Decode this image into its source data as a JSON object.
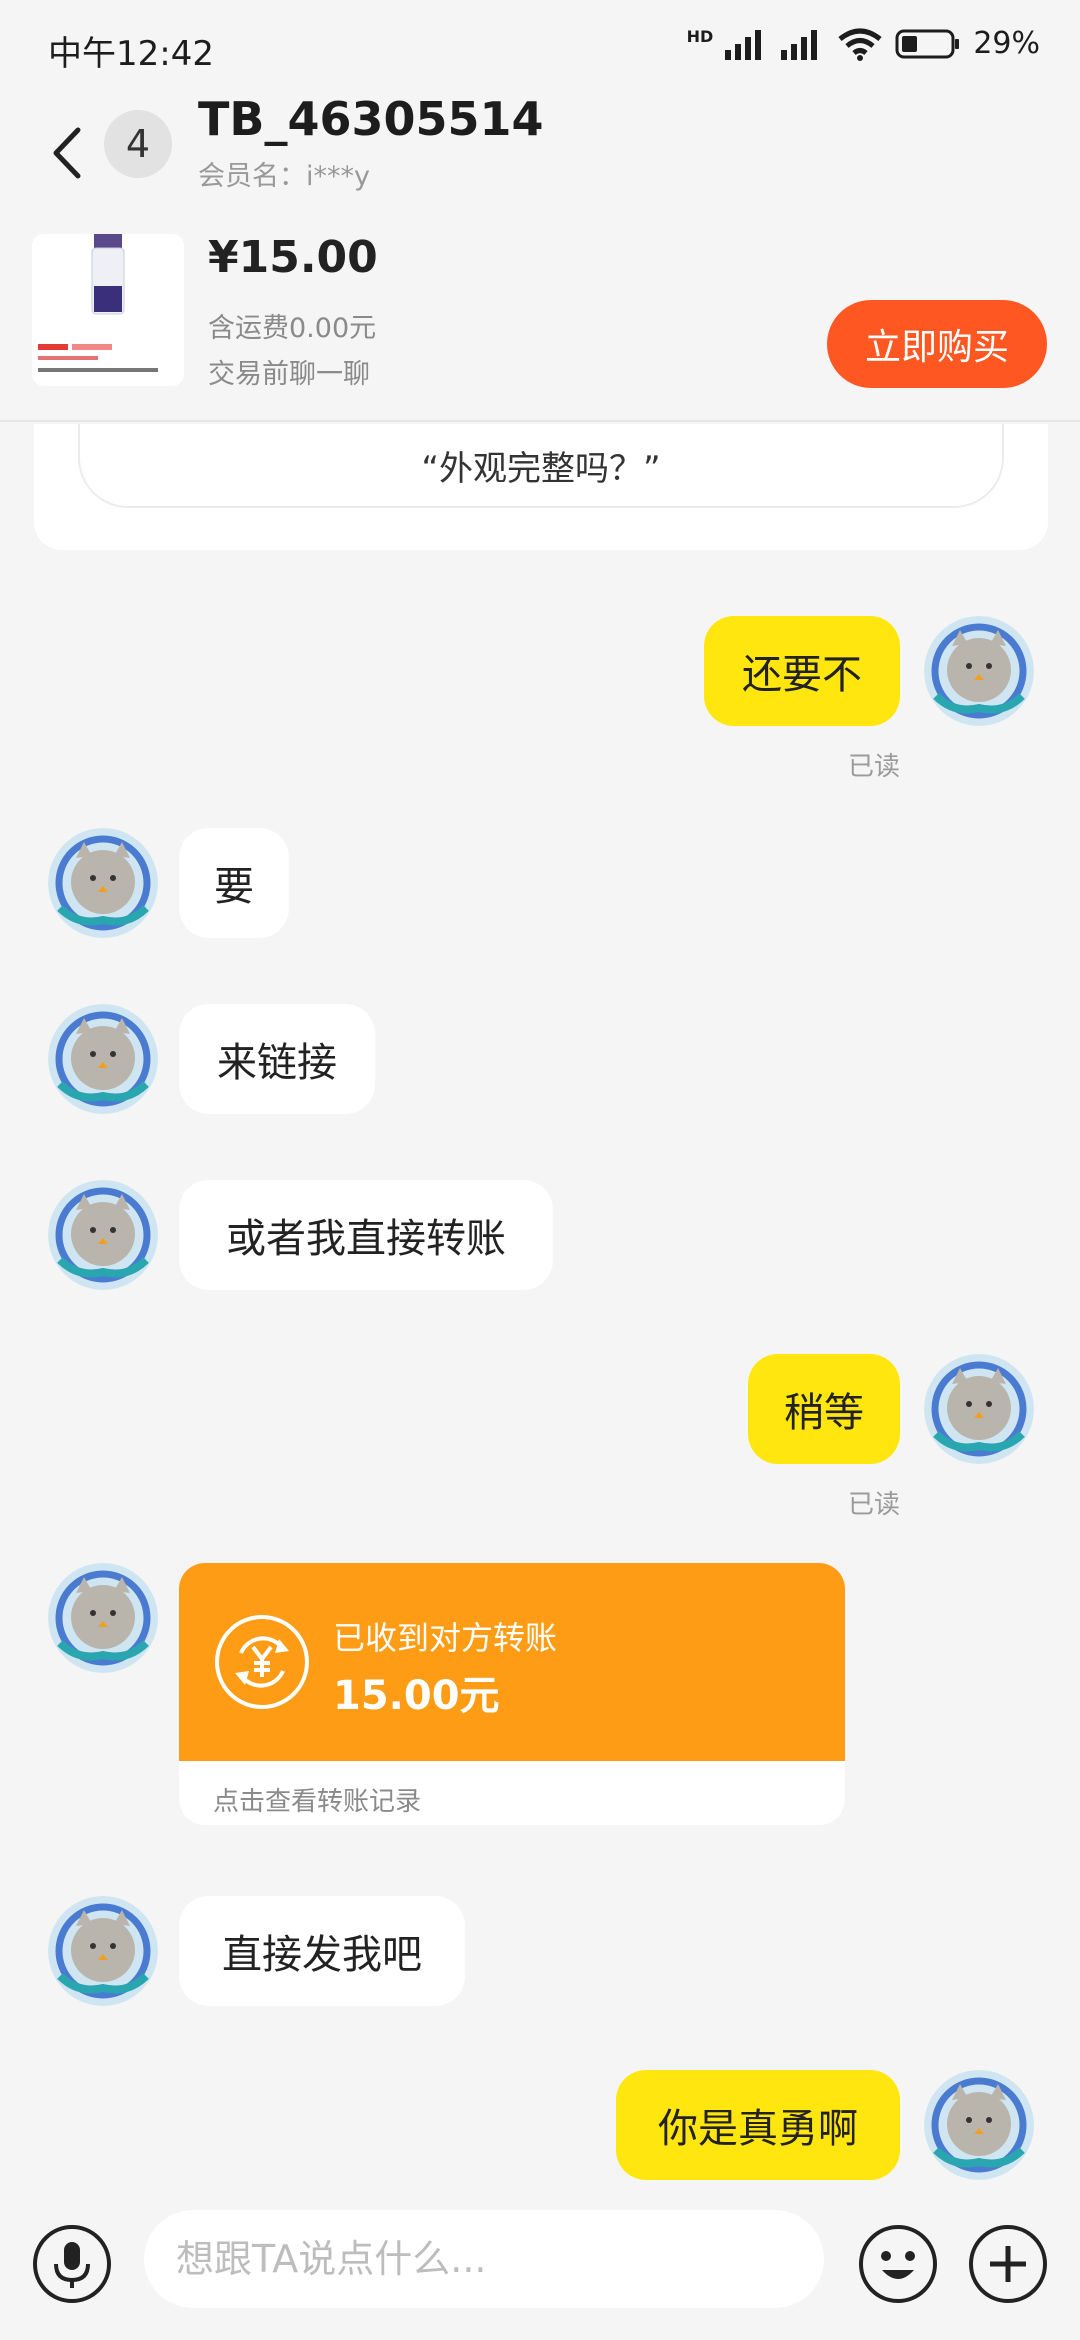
{
  "status_bar": {
    "time": "中午12:42",
    "network": "HD",
    "battery": "29%"
  },
  "header": {
    "back_icon": "chevron-left-icon",
    "unread_count": "4",
    "title": "TB_46305514",
    "subtitle": "会员名：i***y",
    "more_icon": "more-horizontal-icon"
  },
  "product": {
    "price": "¥15.00",
    "shipping": "含运费0.00元",
    "note": "交易前聊一聊",
    "buy_label": "立即购买",
    "buy_color": "#ff5722"
  },
  "quote_card": {
    "text": "“外观完整吗？”"
  },
  "messages": [
    {
      "from": "me",
      "text": "还要不",
      "status": "已读"
    },
    {
      "from": "them",
      "text": "要"
    },
    {
      "from": "them",
      "text": "来链接"
    },
    {
      "from": "them",
      "text": "或者我直接转账"
    },
    {
      "from": "me",
      "text": "稍等",
      "status": "已读"
    },
    {
      "from": "them",
      "type": "transfer"
    },
    {
      "from": "them",
      "text": "直接发我吧"
    },
    {
      "from": "me",
      "text": "你是真勇啊"
    }
  ],
  "transfer": {
    "title": "已收到对方转账",
    "amount": "15.00元",
    "link": "点击查看转账记录",
    "icon": "yuan-transfer-icon",
    "color": "#ff9c15"
  },
  "input_bar": {
    "placeholder": "想跟TA说点什么...",
    "mic_icon": "microphone-icon",
    "emoji_icon": "smile-emoji-icon",
    "plus_icon": "plus-circle-icon"
  },
  "colors": {
    "my_bubble": "#ffe60f",
    "their_bubble": "#ffffff",
    "background": "#f5f5f5"
  }
}
